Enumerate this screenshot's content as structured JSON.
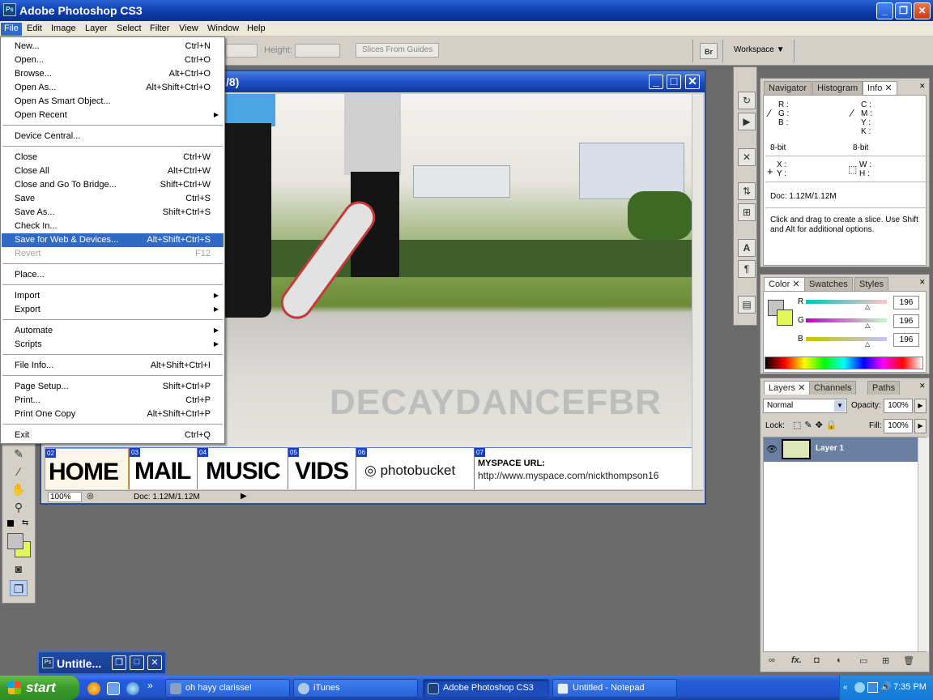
{
  "app": {
    "title": "Adobe Photoshop CS3",
    "icon_text": "Ps",
    "window_buttons": {
      "minimize": "_",
      "restore": "❐",
      "close": "✕"
    }
  },
  "menubar": [
    "File",
    "Edit",
    "Image",
    "Layer",
    "Select",
    "Filter",
    "View",
    "Window",
    "Help"
  ],
  "options_bar": {
    "height_label": "Height:",
    "slices_button": "Slices From Guides",
    "bridge_icon": "Br",
    "workspace_label": "Workspace"
  },
  "file_menu": [
    {
      "label": "New...",
      "shortcut": "Ctrl+N"
    },
    {
      "label": "Open...",
      "shortcut": "Ctrl+O"
    },
    {
      "label": "Browse...",
      "shortcut": "Alt+Ctrl+O"
    },
    {
      "label": "Open As...",
      "shortcut": "Alt+Shift+Ctrl+O"
    },
    {
      "label": "Open As Smart Object...",
      "shortcut": ""
    },
    {
      "label": "Open Recent",
      "shortcut": "",
      "submenu": true
    },
    {
      "sep": true
    },
    {
      "label": "Device Central...",
      "shortcut": ""
    },
    {
      "sep": true
    },
    {
      "label": "Close",
      "shortcut": "Ctrl+W"
    },
    {
      "label": "Close All",
      "shortcut": "Alt+Ctrl+W"
    },
    {
      "label": "Close and Go To Bridge...",
      "shortcut": "Shift+Ctrl+W"
    },
    {
      "label": "Save",
      "shortcut": "Ctrl+S"
    },
    {
      "label": "Save As...",
      "shortcut": "Shift+Ctrl+S"
    },
    {
      "label": "Check In...",
      "shortcut": ""
    },
    {
      "label": "Save for Web & Devices...",
      "shortcut": "Alt+Shift+Ctrl+S",
      "highlighted": true
    },
    {
      "label": "Revert",
      "shortcut": "F12",
      "disabled": true
    },
    {
      "sep": true
    },
    {
      "label": "Place...",
      "shortcut": ""
    },
    {
      "sep": true
    },
    {
      "label": "Import",
      "shortcut": "",
      "submenu": true
    },
    {
      "label": "Export",
      "shortcut": "",
      "submenu": true
    },
    {
      "sep": true
    },
    {
      "label": "Automate",
      "shortcut": "",
      "submenu": true
    },
    {
      "label": "Scripts",
      "shortcut": "",
      "submenu": true
    },
    {
      "sep": true
    },
    {
      "label": "File Info...",
      "shortcut": "Alt+Shift+Ctrl+I"
    },
    {
      "sep": true
    },
    {
      "label": "Page Setup...",
      "shortcut": "Shift+Ctrl+P"
    },
    {
      "label": "Print...",
      "shortcut": "Ctrl+P"
    },
    {
      "label": "Print One Copy",
      "shortcut": "Alt+Shift+Ctrl+P"
    },
    {
      "sep": true
    },
    {
      "label": "Exit",
      "shortcut": "Ctrl+Q"
    }
  ],
  "document": {
    "title_fragment": "/8)",
    "watermark": "DECAYDANCEFBR",
    "nav_links": [
      {
        "tag": "02",
        "label": "HOME"
      },
      {
        "tag": "03",
        "label": "MAIL"
      },
      {
        "tag": "04",
        "label": "MUSIC"
      },
      {
        "tag": "05",
        "label": "VIDS"
      },
      {
        "tag": "06",
        "label": "photobucket"
      },
      {
        "tag": "07",
        "label": "MYSPACE URL:"
      }
    ],
    "myspace_url": "http://www.myspace.com/nickthompson16",
    "zoom": "100%",
    "doc_size": "Doc: 1.12M/1.12M"
  },
  "info_panel": {
    "tabs": [
      "Navigator",
      "Histogram",
      "Info"
    ],
    "active_tab": "Info",
    "left_channels": [
      "R :",
      "G :",
      "B :"
    ],
    "right_channels": [
      "C :",
      "M :",
      "Y :",
      "K :"
    ],
    "bit_left": "8-bit",
    "bit_right": "8-bit",
    "x_label": "X :",
    "y_label": "Y :",
    "w_label": "W :",
    "h_label": "H :",
    "doc": "Doc: 1.12M/1.12M",
    "hint": "Click and drag to create a slice. Use Shift and Alt for additional options."
  },
  "color_panel": {
    "tabs": [
      "Color",
      "Swatches",
      "Styles"
    ],
    "active_tab": "Color",
    "channels": [
      {
        "label": "R",
        "value": "196",
        "fraction": 0.77
      },
      {
        "label": "G",
        "value": "196",
        "fraction": 0.77
      },
      {
        "label": "B",
        "value": "196",
        "fraction": 0.77
      }
    ],
    "fg_color": "#c4c4c4",
    "bg_color": "#e4f75a"
  },
  "layers_panel": {
    "tabs": [
      "Layers",
      "Channels",
      "Paths"
    ],
    "active_tab": "Layers",
    "blend_mode": "Normal",
    "opacity_label": "Opacity:",
    "opacity": "100%",
    "lock_label": "Lock:",
    "fill_label": "Fill:",
    "fill": "100%",
    "layers": [
      {
        "name": "Layer 1"
      }
    ],
    "bottom_icons": [
      "link-icon",
      "fx-icon",
      "mask-icon",
      "adjustment-icon",
      "folder-icon",
      "new-layer-icon",
      "trash-icon"
    ],
    "fx_label": "fx."
  },
  "minimized_window": {
    "title": "Untitle..."
  },
  "taskbar": {
    "start_label": "start",
    "tasks": [
      {
        "label": "oh hayy clarisse!",
        "active": false
      },
      {
        "label": "iTunes",
        "active": false
      },
      {
        "label": "Adobe Photoshop CS3",
        "active": true
      },
      {
        "label": "Untitled - Notepad",
        "active": false
      }
    ],
    "time": "7:35 PM"
  }
}
